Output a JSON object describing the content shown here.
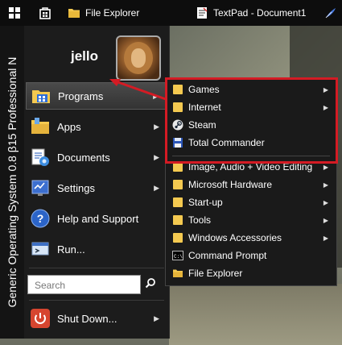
{
  "taskbar": {
    "file_explorer_label": "File Explorer",
    "textpad_label": "TextPad - Document1"
  },
  "start_menu": {
    "side_text": "Generic Operating System 0.8 β15 Professional N",
    "user_name": "jello",
    "items": [
      {
        "label": "Programs"
      },
      {
        "label": "Apps"
      },
      {
        "label": "Documents"
      },
      {
        "label": "Settings"
      },
      {
        "label": "Help and Support"
      },
      {
        "label": "Run..."
      }
    ],
    "search_placeholder": "Search",
    "shutdown_label": "Shut Down..."
  },
  "programs_menu": {
    "items": [
      {
        "label": "Games"
      },
      {
        "label": "Internet"
      },
      {
        "label": "Steam"
      },
      {
        "label": "Total Commander"
      },
      {
        "label": "Image, Audio + Video Editing"
      },
      {
        "label": "Microsoft Hardware"
      },
      {
        "label": "Start-up"
      },
      {
        "label": "Tools"
      },
      {
        "label": "Windows Accessories"
      },
      {
        "label": "Command Prompt"
      },
      {
        "label": "File Explorer"
      }
    ]
  },
  "colors": {
    "highlight_border": "#d41b24",
    "folder": "#f4c950"
  }
}
